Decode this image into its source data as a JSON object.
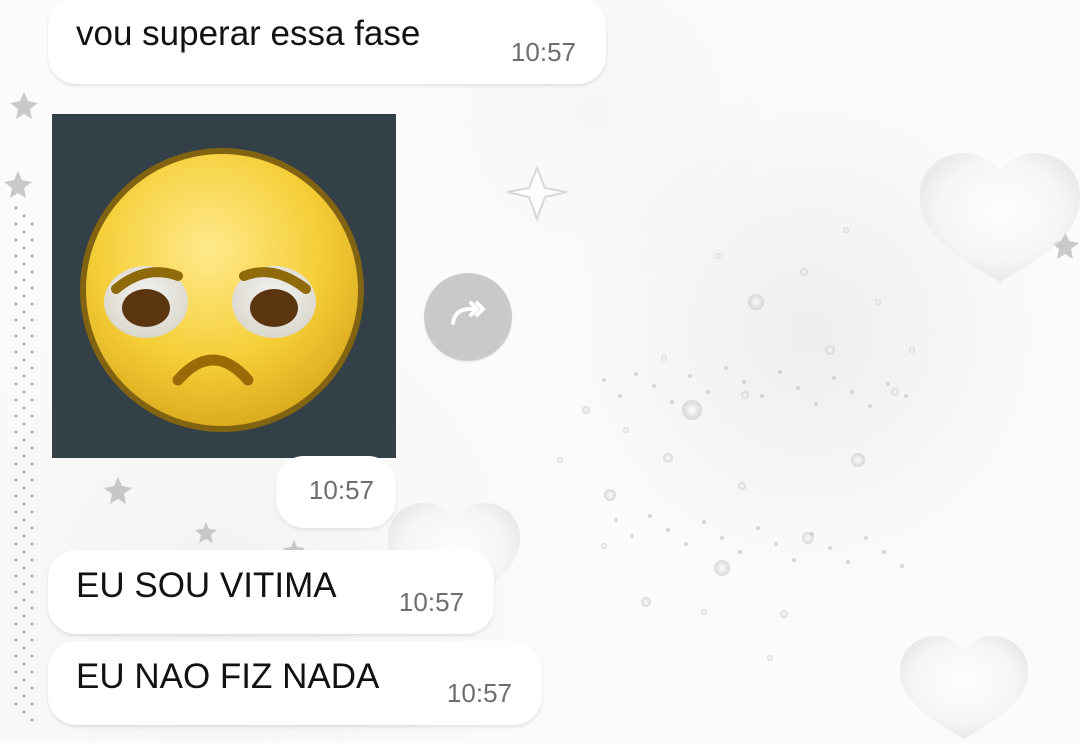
{
  "chat": {
    "messages": [
      {
        "text": "vou superar essa fase",
        "time": "10:57"
      },
      {
        "sticker_icon": "sad-face-sticker-icon",
        "time": "10:57"
      },
      {
        "text": "EU SOU VITIMA",
        "time": "10:57"
      },
      {
        "text": "EU NAO FIZ NADA",
        "time": "10:57"
      }
    ],
    "forward_icon": "forward-icon"
  },
  "colors": {
    "background": "#fbfbfb",
    "bubble": "#ffffff",
    "sticker_bg": "#334048",
    "forward_button": "#c9c9c9",
    "text": "#121212",
    "time": "#6e6e6e"
  }
}
